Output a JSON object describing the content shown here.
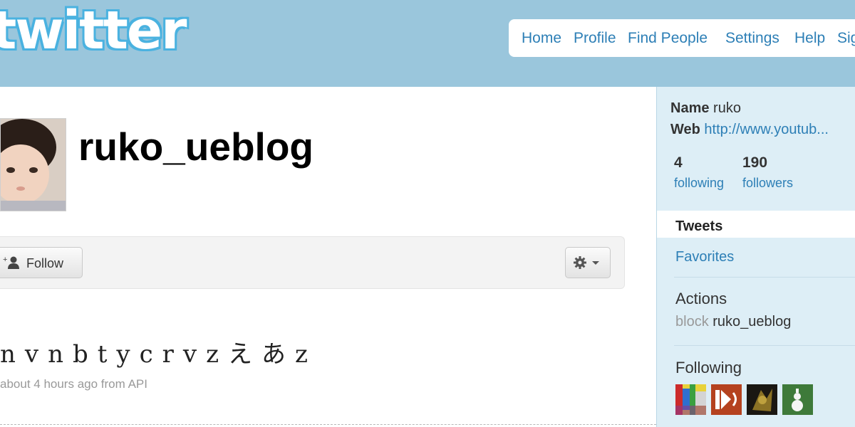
{
  "header": {
    "logo_text": "twitter",
    "nav": [
      "Home",
      "Profile",
      "Find People",
      "Settings",
      "Help",
      "Sign out"
    ]
  },
  "profile": {
    "username": "ruko_ueblog",
    "follow_label": "Follow"
  },
  "tweet": {
    "text": "nvnbtycrvzえあz",
    "meta": "about 4 hours ago from API"
  },
  "sidebar": {
    "name_label": "Name",
    "name_value": "ruko",
    "web_label": "Web",
    "web_value": "http://www.youtub...",
    "following_count": "4",
    "following_label": "following",
    "followers_count": "190",
    "followers_label": "followers",
    "tweets_tab": "Tweets",
    "favorites_link": "Favorites",
    "actions_heading": "Actions",
    "block_label": "block",
    "block_user": "ruko_ueblog",
    "following_heading": "Following"
  },
  "colors": {
    "header_bg": "#9ac6dc",
    "link": "#2d7fb6",
    "sidebar_bg": "#ddeef6"
  }
}
